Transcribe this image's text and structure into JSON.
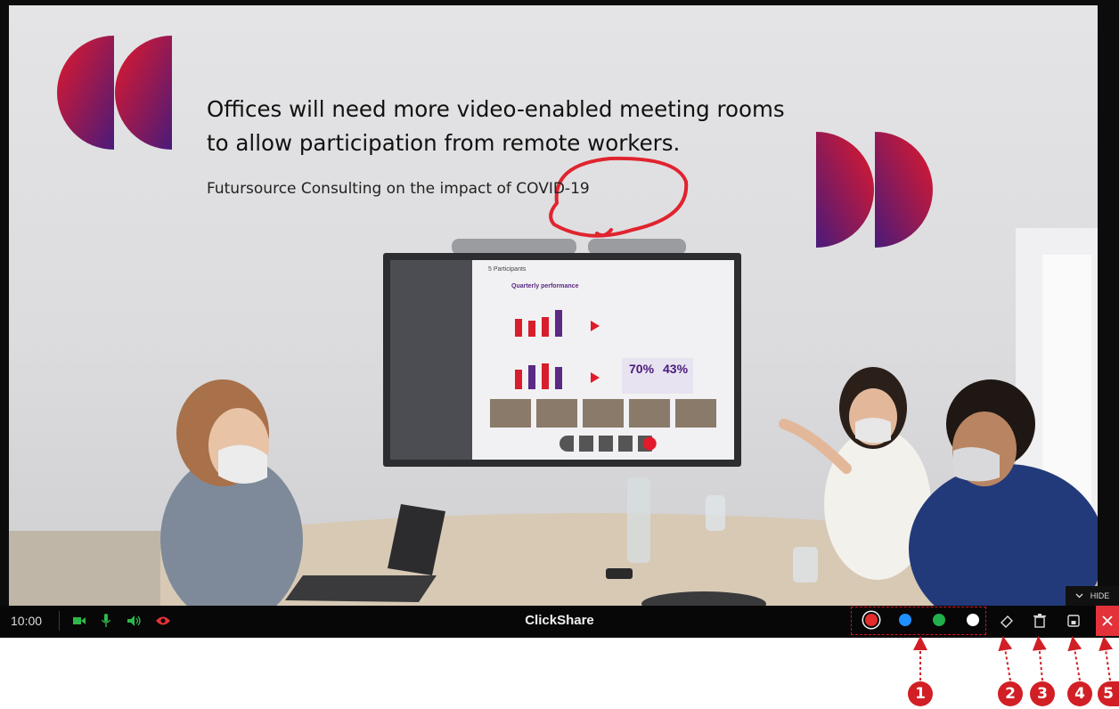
{
  "slide": {
    "headline_line1": "Offices will need more video-enabled meeting rooms",
    "headline_line2": "to allow participation from remote workers.",
    "subtitle": "Futursource Consulting on the impact of COVID-19",
    "tv_label_participants": "5 Participants",
    "tv_chart_title": "Quarterly performance",
    "tv_stat_1": "70%",
    "tv_stat_2": "43%"
  },
  "toolbar": {
    "time": "10:00",
    "title": "ClickShare",
    "hide_label": "HIDE",
    "icons": [
      "camera-icon",
      "microphone-icon",
      "speaker-icon",
      "eye-icon"
    ],
    "pen_colors": [
      "#e52b2b",
      "#1e90ff",
      "#22b04a",
      "#ffffff"
    ],
    "tools": [
      "eraser-icon",
      "trash-icon",
      "save-icon",
      "close-icon"
    ]
  },
  "callouts": [
    "1",
    "2",
    "3",
    "4",
    "5"
  ],
  "colors": {
    "accent": "#d11f25",
    "close_bg": "#e3323a",
    "toolbar_bg": "#070707"
  }
}
